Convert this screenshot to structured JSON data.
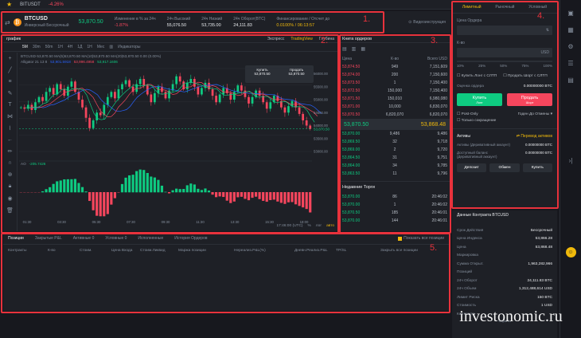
{
  "topbar": {
    "symbol": "BITUSDT",
    "change": "-4.26%"
  },
  "header": {
    "symbol": "BTCUSD",
    "desc": "Инверсный Бессрочный",
    "price": "53,870.50",
    "stats": [
      {
        "label": "Изменение в % за 24ч",
        "value": "-1.87%"
      },
      {
        "label": "24ч Высокий",
        "value": "55,076.50"
      },
      {
        "label": "24ч Низкий",
        "value": "53,735.00"
      },
      {
        "label": "24ч Оборот(BTC)",
        "value": "24,111.83"
      },
      {
        "label": "Финансирование / Отсчет до",
        "value": "0.0100% / 06:13:57"
      }
    ],
    "video": "Видеоинструкция"
  },
  "chart": {
    "title": "график",
    "views": [
      "Экспресс",
      "TradingView",
      "Глубина"
    ],
    "timeframes": [
      "5M",
      "30m",
      "50m",
      "1H",
      "4H",
      "1Д",
      "1Н",
      "Мес"
    ],
    "indicators": "Индикаторы",
    "ohlc": "BTCUSD·53,870.50 MA(5)53,870.50 MA(10)53,870.50 MA(20)53,870.50 0.00 (0.00%)",
    "alligator": "Alligator 21 13 8",
    "alligator_vals": [
      "53,901.5918",
      "53,996.4958",
      "53,917.1606"
    ],
    "buy": "Купить",
    "sell": "Продать",
    "buy_px": "53,870.50",
    "sell_px": "53,870.50",
    "ao": "AO",
    "ao_val": "-205.7426",
    "yaxis": [
      "56000.00",
      "55500.00",
      "55000.00",
      "54500.00",
      "54000.00",
      "53500.00",
      "53000.00"
    ],
    "xaxis": [
      "01:30",
      "03:30",
      "05:30",
      "07:30",
      "09:30",
      "11:30",
      "13:30",
      "15:30",
      "18:00"
    ],
    "time": "17:46:00 (UTC)",
    "pct": "%",
    "log": "лог",
    "auto": "авто",
    "last_price": "53,870.50",
    "candles": [
      54700,
      54650,
      54800,
      54600,
      54900,
      55100,
      54950,
      55300,
      55450,
      55200,
      55600,
      55400,
      55150,
      55500,
      55700,
      55300,
      55000,
      54700,
      54300,
      53900,
      54200,
      54500,
      54400,
      54800,
      55100,
      55300,
      55050,
      55400,
      55600,
      55750,
      55500,
      55300,
      55600,
      55800,
      55550,
      55200,
      54900,
      55250,
      55500,
      55300,
      55050,
      55350,
      55600,
      55900,
      55700,
      55400,
      55650,
      55800,
      55500,
      55200,
      55450,
      55650,
      55400,
      55150,
      54900,
      55200,
      55450,
      55250,
      55000,
      55300,
      55550,
      55350,
      55100,
      54850,
      55100,
      55350,
      55150,
      54900,
      54650,
      54900,
      55150,
      54950,
      54700,
      54500,
      54750,
      54950,
      54700,
      54450,
      54200,
      54000,
      53870
    ]
  },
  "orderbook": {
    "title": "Книга ордеров",
    "cols": [
      "Цена",
      "К-во",
      "Всего USD"
    ],
    "asks": [
      [
        "53,874.50",
        "949",
        "7,151,609"
      ],
      [
        "53,874.00",
        "200",
        "7,150,600"
      ],
      [
        "53,873.50",
        "1",
        "7,150,400"
      ],
      [
        "53,872.50",
        "150,000",
        "7,150,400"
      ],
      [
        "53,871.50",
        "150,010",
        "6,980,080"
      ],
      [
        "53,871.00",
        "10,000",
        "6,830,070"
      ],
      [
        "53,870.50",
        "6,820,070",
        "6,820,070"
      ]
    ],
    "mid": "53,870.50",
    "mark": "53,868.48",
    "bids": [
      [
        "53,870.00",
        "9,486",
        "9,486"
      ],
      [
        "53,869.50",
        "32",
        "9,718"
      ],
      [
        "53,869.00",
        "2",
        "9,720"
      ],
      [
        "53,864.50",
        "31",
        "9,751"
      ],
      [
        "53,864.00",
        "34",
        "9,785"
      ],
      [
        "53,863.50",
        "11",
        "9,796"
      ]
    ],
    "trades_title": "Недавние Торги",
    "trades": [
      [
        "53,870.00",
        "86",
        "20:46:02"
      ],
      [
        "53,870.00",
        "1",
        "20:46:02"
      ],
      [
        "53,870.50",
        "185",
        "20:46:01"
      ],
      [
        "53,870.00",
        "144",
        "20:46:01"
      ]
    ]
  },
  "positions": {
    "tabs": [
      "Позиции",
      "Закрытые P&L",
      "Активные 0",
      "Условные 0",
      "Исполненные",
      "История Ордеров"
    ],
    "show_all": "Показать все позиции",
    "cols": [
      "Контракты",
      "К-во",
      "Стоим.",
      "Цена Входа",
      "Стоим.Ликвид",
      "Маржа позиции",
      "Нереализ.P&L(%)",
      "Дневн.Реализ.P&L",
      "TP/SL",
      "Закрыть все позиции"
    ]
  },
  "order": {
    "tabs": [
      "Лимитный",
      "Рыночный",
      "Условный"
    ],
    "price_label": "Цена Ордера",
    "qty_label": "К-во",
    "unit": "USD",
    "pcts": [
      "10%",
      "25%",
      "50%",
      "75%",
      "100%"
    ],
    "tp_long": "Купить Лонг с СЛТП",
    "tp_short": "Продать Шорт с СЛТП",
    "cost_label": "Оценка ордера",
    "cost_val": "0.00000000 BTC",
    "buy": "Купить",
    "buy_sub": "Лонг",
    "sell": "Продать",
    "sell_sub": "Шорт",
    "post_only": "Post-Only",
    "gtc": "Годен До Отмены",
    "reduce": "Только сокращение",
    "assets": "Активы",
    "transfer": "Перевод активов",
    "acc_label": "Активы (Деривативный аккаунт)",
    "acc_val": "0.00000000 BTC",
    "avail_label": "Доступный баланс (Деривативный аккаунт)",
    "avail_val": "0.00000000 BTC",
    "btns": [
      "Депозит",
      "Обмен",
      "Купить"
    ]
  },
  "info": {
    "title": "Данные Контракта BTCUSD",
    "rows": [
      [
        "Срок Действия",
        "Бессрочный"
      ],
      [
        "Цена Индекса",
        "53,866.28"
      ],
      [
        "Цена",
        "53,868.48"
      ],
      [
        "Маркировка",
        ""
      ],
      [
        "Сумма Открыт.",
        "1,963,282,966"
      ],
      [
        "Позиций",
        ""
      ],
      [
        "24ч Оборот",
        "24,111.83 BTC"
      ],
      [
        "24ч Объем",
        "1,312,488,614 USD"
      ],
      [
        "Лимит Риска",
        "150 BTC"
      ],
      [
        "Стоимость",
        "1 USD"
      ],
      [
        "Контракта",
        ""
      ]
    ],
    "hide": "Скрыть"
  },
  "labels": [
    "1.",
    "2.",
    "3.",
    "4.",
    "5."
  ],
  "watermark": "investonomic.ru"
}
